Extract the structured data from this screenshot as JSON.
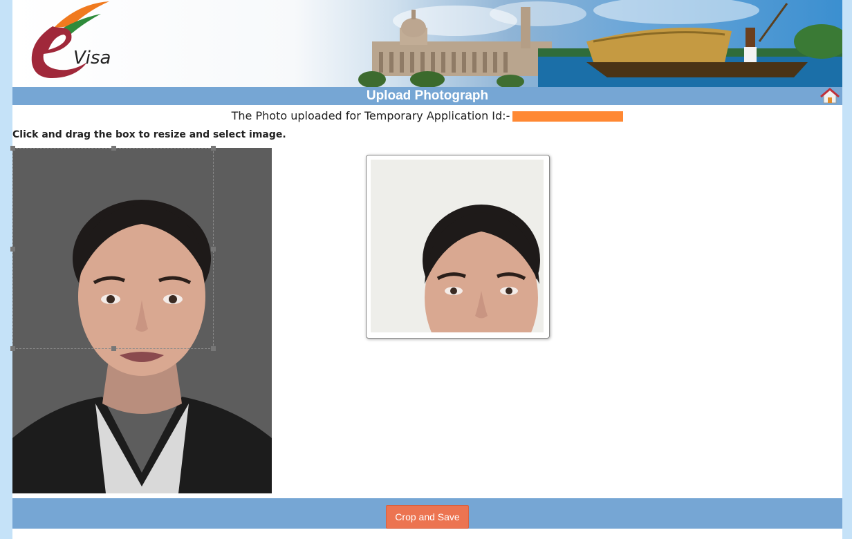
{
  "banner": {
    "logo_text": "Visa",
    "logo_letter": "e"
  },
  "header": {
    "title": "Upload Photograph"
  },
  "application": {
    "id_label": "The Photo uploaded for Temporary Application Id:-",
    "redaction_color": "#ff8833"
  },
  "instructions": "Click and drag the box to resize and select image.",
  "footer": {
    "crop_button_label": "Crop and Save"
  },
  "colors": {
    "title_bar": "#76a6d4",
    "button": "#ec7451",
    "page_background": "#c5e2f8"
  },
  "icons": {
    "home": "home-icon"
  }
}
